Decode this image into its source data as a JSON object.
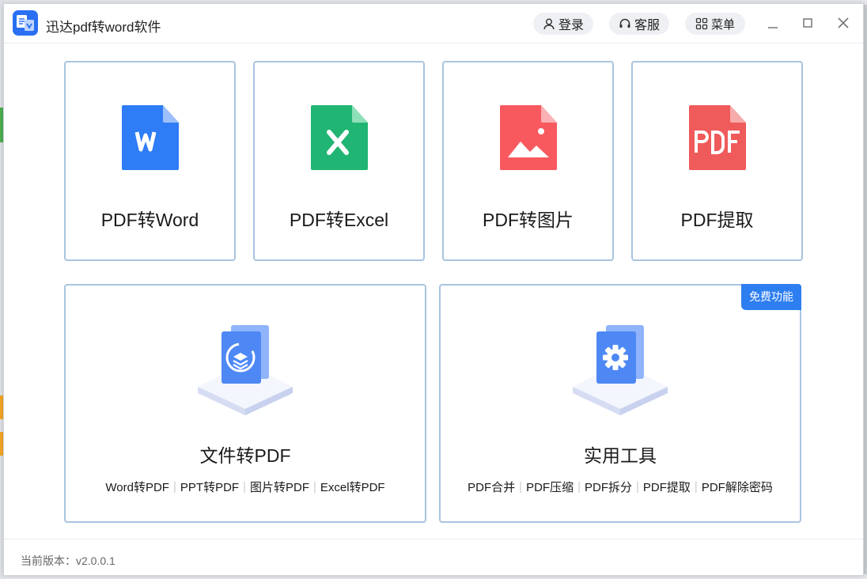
{
  "app": {
    "title": "迅达pdf转word软件"
  },
  "header": {
    "login_label": "登录",
    "service_label": "客服",
    "menu_label": "菜单"
  },
  "tools": [
    {
      "label": "PDF转Word",
      "icon": "word-doc-icon",
      "color": "#2e7cf6"
    },
    {
      "label": "PDF转Excel",
      "icon": "excel-doc-icon",
      "color": "#21b573"
    },
    {
      "label": "PDF转图片",
      "icon": "image-doc-icon",
      "color": "#f7595f"
    },
    {
      "label": "PDF提取",
      "icon": "pdf-doc-icon",
      "color": "#ef5a5a"
    }
  ],
  "panels": [
    {
      "title": "文件转PDF",
      "icon": "convert-to-pdf-icon",
      "links": [
        "Word转PDF",
        "PPT转PDF",
        "图片转PDF",
        "Excel转PDF"
      ]
    },
    {
      "title": "实用工具",
      "icon": "settings-tool-icon",
      "badge": "免费功能",
      "links": [
        "PDF合并",
        "PDF压缩",
        "PDF拆分",
        "PDF提取",
        "PDF解除密码"
      ]
    }
  ],
  "footer": {
    "version": "当前版本：v2.0.0.1"
  },
  "colors": {
    "accent": "#2d7ef0",
    "card_border": "#a9c4df"
  }
}
